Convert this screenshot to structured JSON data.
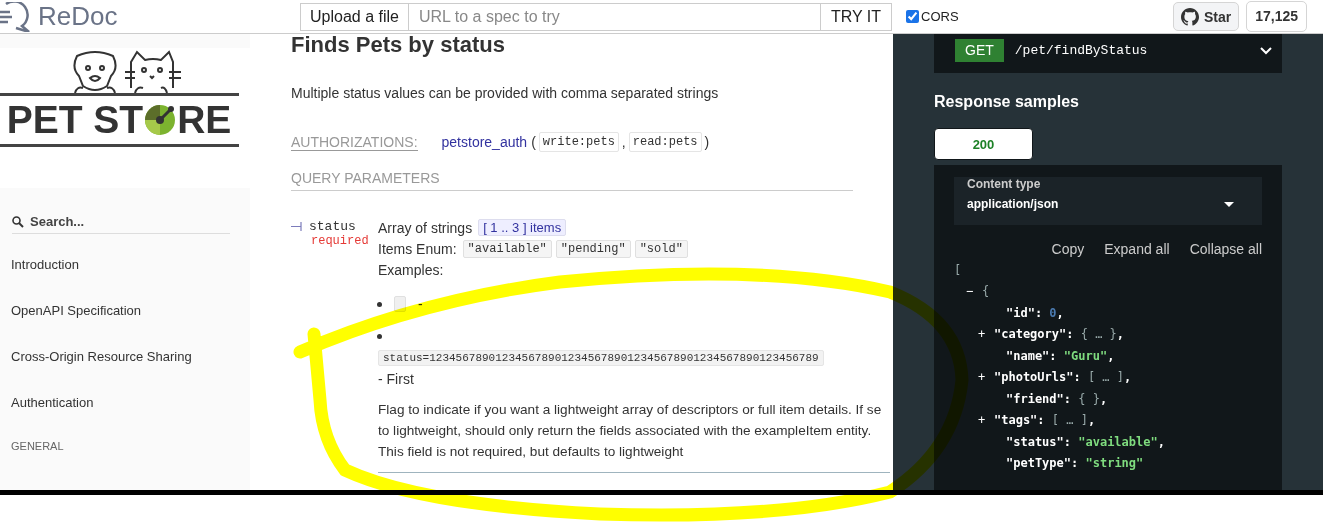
{
  "header": {
    "brand": "ReDoc",
    "upload_button": "Upload a file",
    "url_field": {
      "placeholder": "URL to a spec to try"
    },
    "try_button": "TRY IT",
    "cors": {
      "label": "CORS",
      "checked": true
    },
    "star_button": "Star",
    "star_count": "17,125"
  },
  "sidebar": {
    "logo": {
      "text_before": "PET ST",
      "text_after": "RE"
    },
    "search": {
      "placeholder": "Search..."
    },
    "items": [
      {
        "label": "Introduction",
        "kind": "item"
      },
      {
        "label": "OpenAPI Specification",
        "kind": "item"
      },
      {
        "label": "Cross-Origin Resource Sharing",
        "kind": "item"
      },
      {
        "label": "Authentication",
        "kind": "item"
      },
      {
        "label": "GENERAL",
        "kind": "section"
      }
    ]
  },
  "operation": {
    "title": "Finds Pets by status",
    "description": "Multiple status values can be provided with comma separated strings",
    "authorizations": {
      "label": "AUTHORIZATIONS:",
      "scheme": "petstore_auth",
      "open": "(",
      "scopes": [
        "write:pets",
        "read:pets"
      ],
      "separator": ",",
      "close": ")"
    },
    "query_title": "QUERY PARAMETERS",
    "param": {
      "name": "status",
      "required": "required",
      "type": "Array of strings",
      "constraint": "[ 1 .. 3 ] items",
      "enum_label": "Items Enum:",
      "enum": [
        "\"available\"",
        "\"pending\"",
        "\"sold\""
      ],
      "examples_label": "Examples:",
      "examples": [
        {
          "text": "-"
        },
        {
          "code": "status=12345678901234567890123456789012345678901234567890123456789"
        }
      ],
      "after_examples": "- First",
      "description": "Flag to indicate if you want a lightweight array of descriptors or full item details. If se to lightweight, should only return the fields associated with the exampleItem entity. This field is not required, but defaults to lightweight"
    }
  },
  "samples": {
    "method": "GET",
    "path": "/pet/findByStatus",
    "title": "Response samples",
    "tabs": [
      {
        "label": "200",
        "selected": true
      }
    ],
    "content_type_label": "Content type",
    "content_type": "application/json",
    "actions": [
      "Copy",
      "Expand all",
      "Collapse all"
    ],
    "json": {
      "open": "[",
      "children": [
        {
          "toggle": "−",
          "open": "{",
          "children": [
            {
              "key": "\"id\": ",
              "value": "0",
              "end": ",",
              "kind": "number"
            },
            {
              "toggle": "+",
              "key": "\"category\": ",
              "value": "{ … }",
              "end": ",",
              "kind": "collapsed"
            },
            {
              "key": "\"name\": ",
              "value": "\"Guru\"",
              "end": ",",
              "kind": "string"
            },
            {
              "toggle": "+",
              "key": "\"photoUrls\": ",
              "value": "[ … ]",
              "end": ",",
              "kind": "collapsed"
            },
            {
              "key": "\"friend\": ",
              "value": "{ }",
              "end": ",",
              "kind": "collapsed"
            },
            {
              "toggle": "+",
              "key": "\"tags\": ",
              "value": "[ … ]",
              "end": ",",
              "kind": "collapsed"
            },
            {
              "key": "\"status\": ",
              "value": "\"available\"",
              "end": ",",
              "kind": "string"
            },
            {
              "key": "\"petType\": ",
              "value": "\"string\"",
              "kind": "string"
            }
          ]
        }
      ]
    }
  }
}
